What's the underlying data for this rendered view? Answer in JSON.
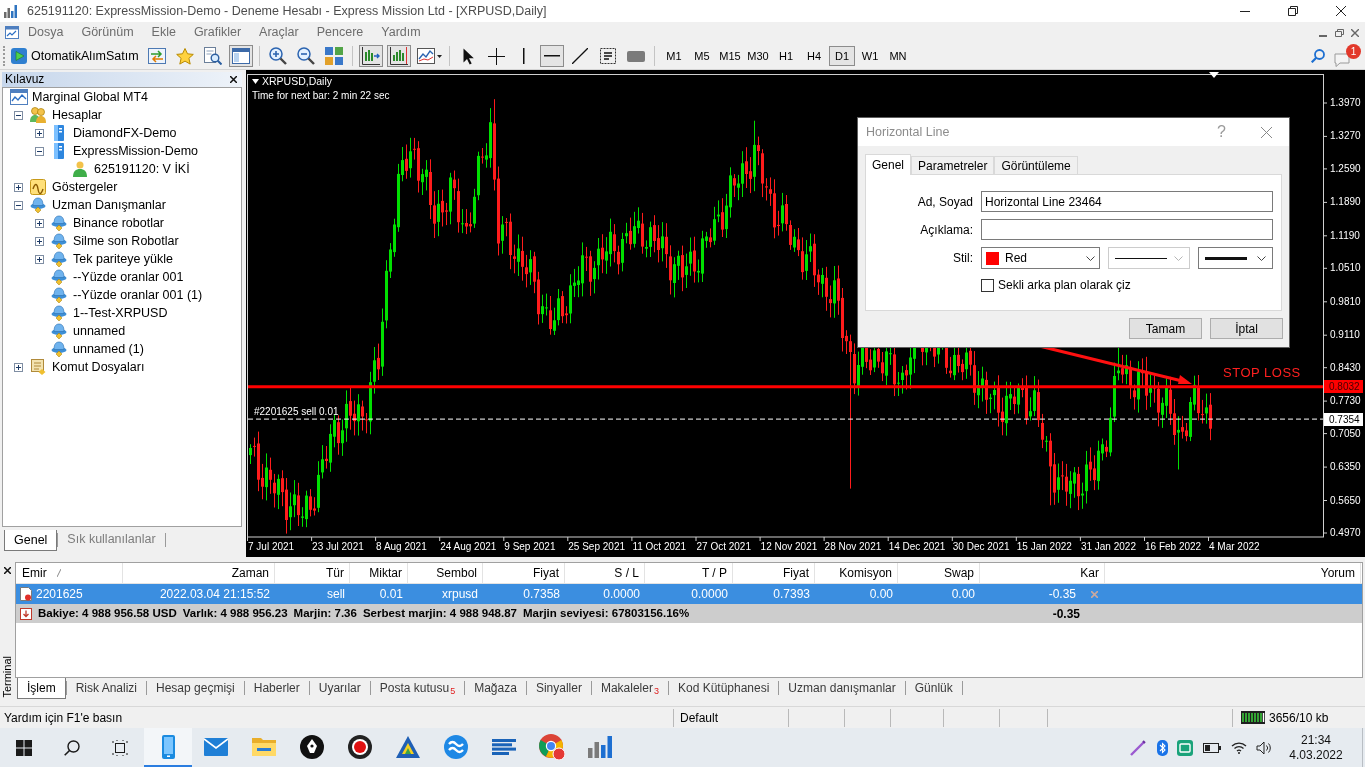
{
  "title_bar": {
    "title": "625191120: ExpressMission-Demo - Deneme Hesabı - Express Mission Ltd - [XRPUSD,Daily]"
  },
  "menu": [
    "Dosya",
    "Görünüm",
    "Ekle",
    "Grafikler",
    "Araçlar",
    "Pencere",
    "Yardım"
  ],
  "toolbar": {
    "auto_trading": "OtomatikAlımSatım",
    "groups": [
      [
        {
          "kind": "swap-arrows",
          "pressed": false
        },
        {
          "kind": "star",
          "pressed": false
        },
        {
          "kind": "document-magnifier",
          "pressed": false
        },
        {
          "kind": "panel",
          "pressed": true
        }
      ],
      [
        {
          "kind": "zoom-in",
          "pressed": false
        },
        {
          "kind": "zoom-out",
          "pressed": false
        },
        {
          "kind": "grid",
          "pressed": false
        }
      ],
      [
        {
          "kind": "chart-shift",
          "pressed": true
        },
        {
          "kind": "chart-scroll",
          "pressed": true
        },
        {
          "kind": "line-chart",
          "pressed": false
        }
      ],
      [
        {
          "kind": "cursor",
          "pressed": false
        },
        {
          "kind": "crosshair",
          "pressed": false
        },
        {
          "kind": "vertical-line",
          "pressed": false
        },
        {
          "kind": "horizontal-line",
          "pressed": true
        },
        {
          "kind": "diagonal-line",
          "pressed": false
        },
        {
          "kind": "text-frame",
          "pressed": false
        },
        {
          "kind": "rectangle",
          "pressed": false
        }
      ]
    ],
    "timeframes": [
      {
        "label": "M1",
        "selected": false
      },
      {
        "label": "M5",
        "selected": false
      },
      {
        "label": "M15",
        "selected": false
      },
      {
        "label": "M30",
        "selected": false
      },
      {
        "label": "H1",
        "selected": false
      },
      {
        "label": "H4",
        "selected": false
      },
      {
        "label": "D1",
        "selected": true
      },
      {
        "label": "W1",
        "selected": false
      },
      {
        "label": "MN",
        "selected": false
      }
    ],
    "notifications": "1"
  },
  "navigator": {
    "title": "Kılavuz",
    "tree": [
      {
        "label": "Marginal Global MT4",
        "kind": "terminal",
        "children": [
          {
            "label": "Hesaplar",
            "kind": "accounts",
            "expanded": true,
            "children": [
              {
                "label": "DiamondFX-Demo",
                "kind": "server",
                "expanded": false
              },
              {
                "label": "ExpressMission-Demo",
                "kind": "server",
                "expanded": true,
                "children": [
                  {
                    "label": "625191120: V İKİ",
                    "kind": "user"
                  }
                ]
              }
            ]
          },
          {
            "label": "Göstergeler",
            "kind": "indicators",
            "expanded": false
          },
          {
            "label": "Uzman Danışmanlar",
            "kind": "experts",
            "expanded": true,
            "children": [
              {
                "label": "Binance robotlar",
                "kind": "expert",
                "expanded": false
              },
              {
                "label": "Silme son Robotlar",
                "kind": "expert",
                "expanded": false
              },
              {
                "label": "Tek pariteye yükle",
                "kind": "expert",
                "expanded": false
              },
              {
                "label": "--Yüzde oranlar 001",
                "kind": "expert"
              },
              {
                "label": "--Yüzde oranlar 001 (1)",
                "kind": "expert"
              },
              {
                "label": "1--Test-XRPUSD",
                "kind": "expert"
              },
              {
                "label": "unnamed",
                "kind": "expert"
              },
              {
                "label": "unnamed (1)",
                "kind": "expert"
              }
            ]
          },
          {
            "label": "Komut Dosyaları",
            "kind": "scripts",
            "expanded": false
          }
        ]
      }
    ],
    "tabs": [
      {
        "label": "Genel",
        "selected": true
      },
      {
        "label": "Sık kullanılanlar",
        "selected": false
      }
    ]
  },
  "chart": {
    "symbol": "XRPUSD,Daily",
    "timer": "Time for next bar: 2 min 22 sec",
    "price_axis": [
      "1.3970",
      "1.3270",
      "1.2590",
      "1.1890",
      "1.1190",
      "1.0510",
      "0.9810",
      "0.9110",
      "0.8430",
      "0.7730",
      "0.7050",
      "0.6350",
      "0.5650",
      "0.4970"
    ],
    "date_axis": [
      "7 Jul 2021",
      "23 Jul 2021",
      "8 Aug 2021",
      "24 Aug 2021",
      "9 Sep 2021",
      "25 Sep 2021",
      "11 Oct 2021",
      "27 Oct 2021",
      "12 Nov 2021",
      "28 Nov 2021",
      "14 Dec 2021",
      "30 Dec 2021",
      "15 Jan 2022",
      "31 Jan 2022",
      "16 Feb 2022",
      "4 Mar 2022"
    ],
    "stop_line": {
      "price": "0.8032",
      "label": "STOP LOSS"
    },
    "order_line": {
      "label": "#2201625 sell 0.01",
      "price": "0.7354"
    }
  },
  "dialog": {
    "title": "Horizontal Line",
    "help": "?",
    "tabs": [
      {
        "label": "Genel",
        "selected": true
      },
      {
        "label": "Parametreler",
        "selected": false
      },
      {
        "label": "Görüntüleme",
        "selected": false
      }
    ],
    "fields": [
      {
        "label": "Ad, Soyad",
        "value": "Horizontal Line 23464"
      },
      {
        "label": "Açıklama:"
      }
    ],
    "style_label": "Stil:",
    "style": [
      {
        "kind": "color",
        "value": "Red",
        "color": "#ff0000",
        "disabled": false
      },
      {
        "kind": "line",
        "disabled": true
      },
      {
        "kind": "width",
        "disabled": false
      }
    ],
    "background": {
      "label": "Sekli arka plan olarak çiz",
      "checked": false
    },
    "buttons": [
      "Tamam",
      "İptal"
    ]
  },
  "terminal": {
    "title": "Terminal",
    "columns": [
      {
        "label": "Emir",
        "sorted": true
      },
      {
        "label": "Zaman",
        "sorted": false
      },
      {
        "label": "Tür",
        "sorted": false
      },
      {
        "label": "Miktar",
        "sorted": false
      },
      {
        "label": "Sembol",
        "sorted": false
      },
      {
        "label": "Fiyat",
        "sorted": false
      },
      {
        "label": "S / L",
        "sorted": false
      },
      {
        "label": "T / P",
        "sorted": false
      },
      {
        "label": "Fiyat",
        "sorted": false
      },
      {
        "label": "Komisyon",
        "sorted": false
      },
      {
        "label": "Swap",
        "sorted": false
      },
      {
        "label": "Kar",
        "sorted": false
      },
      {
        "label": "Yorum",
        "sorted": false
      }
    ],
    "rows": [
      {
        "selected": true,
        "cells": [
          "2201625",
          "2022.03.04 21:15:52",
          "sell",
          "0.01",
          "xrpusd",
          "0.7358",
          "0.0000",
          "0.0000",
          "0.7393",
          "0.00",
          "0.00",
          "-0.35"
        ]
      }
    ],
    "summary": {
      "items": [
        "Bakiye: 4 988 956.58 USD",
        "Varlık: 4 988 956.23",
        "Marjin: 7.36",
        "Serbest marjin: 4 988 948.87",
        "Marjin seviyesi: 67803156.16%"
      ],
      "profit": "-0.35"
    },
    "tabs": [
      {
        "label": "İşlem",
        "selected": true
      },
      {
        "label": "Risk Analizi",
        "selected": false
      },
      {
        "label": "Hesap geçmişi",
        "selected": false
      },
      {
        "label": "Haberler",
        "selected": false
      },
      {
        "label": "Uyarılar",
        "selected": false
      },
      {
        "label": "Posta kutusu",
        "selected": false,
        "badge": "5"
      },
      {
        "label": "Mağaza",
        "selected": false
      },
      {
        "label": "Sinyaller",
        "selected": false
      },
      {
        "label": "Makaleler",
        "selected": false,
        "badge": "3"
      },
      {
        "label": "Kod Kütüphanesi",
        "selected": false
      },
      {
        "label": "Uzman danışmanlar",
        "selected": false
      },
      {
        "label": "Günlük",
        "selected": false
      }
    ]
  },
  "status_bar": {
    "help": "Yardım için F1'e basın",
    "profile": "Default",
    "traffic": "3656/10 kb"
  },
  "taskbar": {
    "apps": [
      {
        "kind": "phone",
        "active": true
      },
      {
        "kind": "mail",
        "active": false
      },
      {
        "kind": "folder",
        "active": false
      },
      {
        "kind": "pen-nib",
        "active": false
      },
      {
        "kind": "record",
        "active": false
      },
      {
        "kind": "triangle",
        "active": false
      },
      {
        "kind": "wave",
        "active": false
      },
      {
        "kind": "stripes",
        "active": false
      },
      {
        "kind": "browser",
        "active": false
      },
      {
        "kind": "bar-chart",
        "active": false
      }
    ],
    "time": "21:34",
    "date": "4.03.2022"
  }
}
